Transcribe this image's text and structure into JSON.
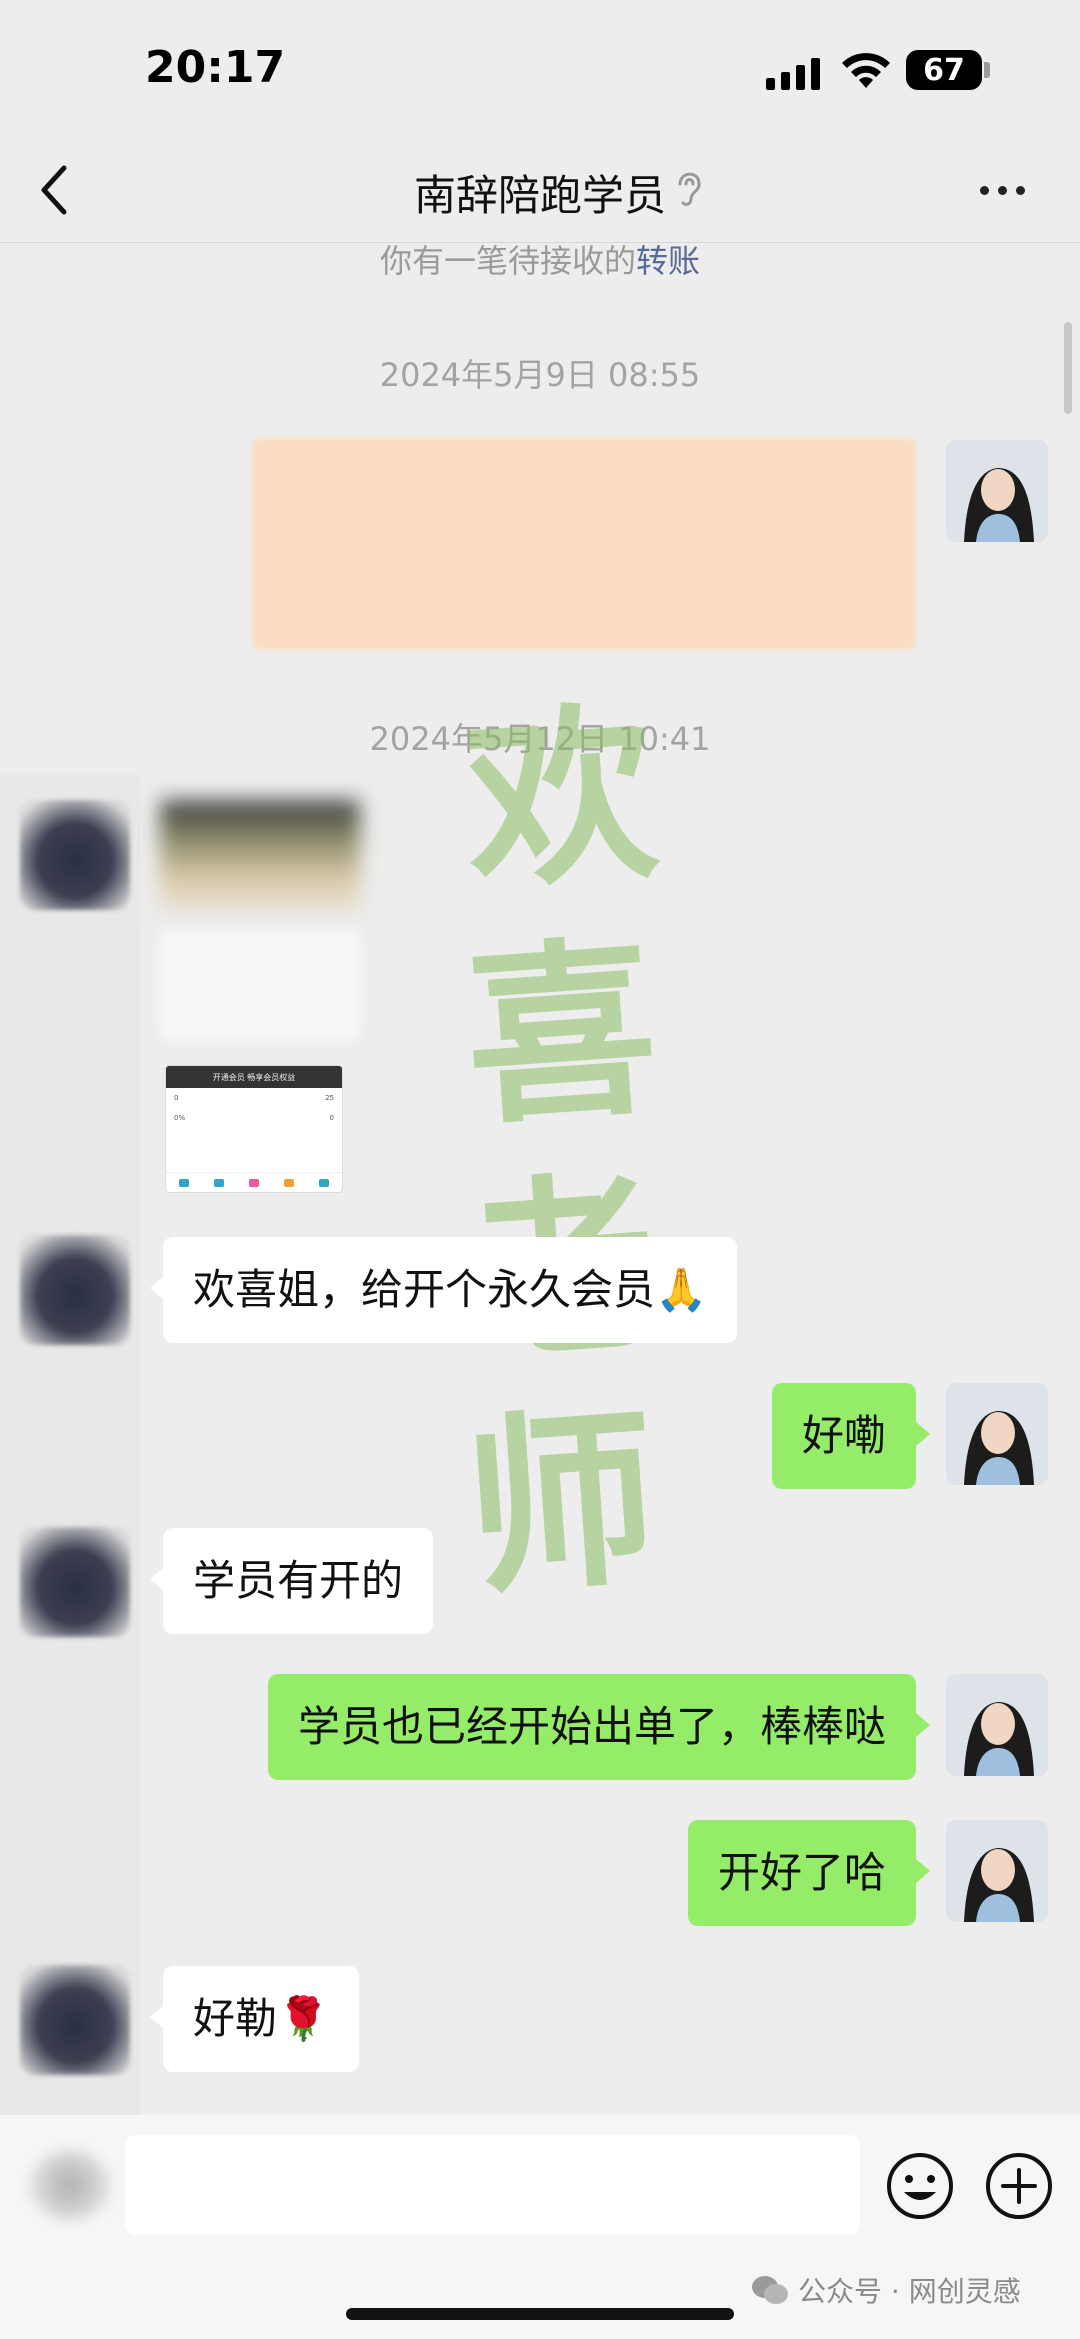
{
  "status_bar": {
    "time": "20:17",
    "battery": "67"
  },
  "nav": {
    "title": "南辞陪跑学员"
  },
  "notice": {
    "text": "你有一笔待接收的",
    "link": "转账"
  },
  "timestamps": [
    "2024年5月9日 08:55",
    "2024年5月12日 10:41"
  ],
  "watermark": [
    "欢",
    "喜",
    "老",
    "师"
  ],
  "mini_screenshot": {
    "bar_text": "开通会员 畅享会员权益",
    "row1_left": "0",
    "row1_right": "25",
    "row2_left": "0%",
    "row2_right": "0"
  },
  "messages": [
    {
      "side": "in",
      "text": "欢喜姐，给开个永久会员🙏"
    },
    {
      "side": "out",
      "text": "好嘞"
    },
    {
      "side": "in",
      "text": "学员有开的"
    },
    {
      "side": "out",
      "text": "学员也已经开始出单了，棒棒哒"
    },
    {
      "side": "out",
      "text": "开好了哈"
    },
    {
      "side": "in",
      "text": "好勒🌹"
    }
  ],
  "footer_watermark": {
    "text": "公众号 · 网创灵感"
  },
  "colors": {
    "bubble_out": "#95ec69",
    "bubble_in": "#ffffff",
    "background": "#ededed",
    "link": "#576b95"
  },
  "icons": [
    "back-arrow-icon",
    "ear-icon",
    "more-dots-icon",
    "emoji-icon",
    "plus-icon",
    "wechat-icon"
  ]
}
